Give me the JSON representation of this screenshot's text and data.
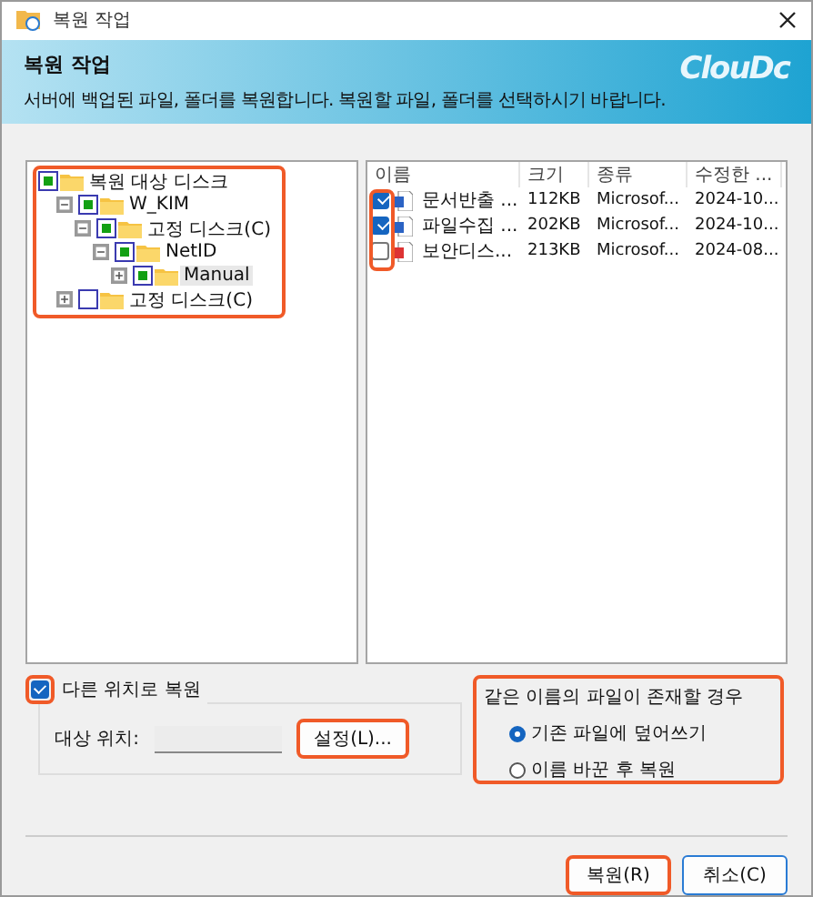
{
  "window": {
    "title": "복원 작업"
  },
  "header": {
    "title": "복원 작업",
    "subtitle": "서버에 백업된 파일, 폴더를 복원합니다. 복원할 파일, 폴더를 선택하시기 바랍니다.",
    "logo": "ClouDc"
  },
  "tree": {
    "highlighted": true,
    "items": [
      {
        "label": "복원 대상 디스크",
        "checked": true,
        "children": [
          {
            "label": "W_KIM",
            "checked": true,
            "expanded": true,
            "children": [
              {
                "label": "고정 디스크(C)",
                "checked": true,
                "expanded": true,
                "children": [
                  {
                    "label": "NetID",
                    "checked": true,
                    "expanded": true,
                    "children": [
                      {
                        "label": "Manual",
                        "checked": true,
                        "expanded": false,
                        "selected": true
                      }
                    ]
                  }
                ]
              }
            ]
          },
          {
            "label": "고정 디스크(C)",
            "checked": false,
            "expanded": false
          }
        ]
      }
    ]
  },
  "files": {
    "checkboxes_highlighted": true,
    "columns": [
      "이름",
      "크기",
      "종류",
      "수정한 ..."
    ],
    "rows": [
      {
        "kind": "word",
        "checked": true,
        "name": "문서반출 ...",
        "size": "112KB",
        "type": "Microsof...",
        "modified": "2024-10..."
      },
      {
        "kind": "word",
        "checked": true,
        "name": "파일수집 ...",
        "size": "202KB",
        "type": "Microsof...",
        "modified": "2024-10..."
      },
      {
        "kind": "pdf",
        "checked": false,
        "name": "보안디스...",
        "size": "213KB",
        "type": "Microsof...",
        "modified": "2024-08..."
      }
    ]
  },
  "alt_location": {
    "checked": true,
    "highlighted": true,
    "label": "다른 위치로 복원",
    "target_label": "대상 위치:",
    "button": {
      "label": "설정(L)...",
      "highlighted": true
    }
  },
  "conflict": {
    "highlighted": true,
    "title": "같은 이름의 파일이 존재할 경우",
    "options": [
      {
        "label": "기존 파일에 덮어쓰기",
        "selected": true
      },
      {
        "label": "이름 바꾼 후 복원",
        "selected": false
      }
    ]
  },
  "buttons": [
    {
      "label": "복원(R)",
      "highlighted": true,
      "default": false
    },
    {
      "label": "취소(C)",
      "highlighted": false,
      "default": true
    }
  ]
}
